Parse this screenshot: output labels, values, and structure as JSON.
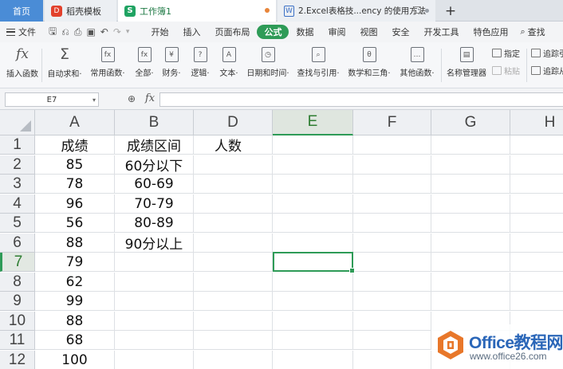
{
  "tabs": {
    "home": "首页",
    "template": "稻壳模板",
    "workbook": "工作簿1",
    "web": "2.Excel表格技...ency 的使用方法",
    "add": "+"
  },
  "menu": {
    "file": "文件",
    "tabs": [
      "开始",
      "插入",
      "页面布局",
      "公式",
      "数据",
      "审阅",
      "视图",
      "安全",
      "开发工具",
      "特色应用"
    ],
    "active": "公式",
    "search": "查找"
  },
  "ribbon": {
    "buttons": [
      {
        "label": "插入函数",
        "icon": "fx"
      },
      {
        "label": "自动求和·",
        "icon": "Σ"
      },
      {
        "label": "常用函数·",
        "icon": "fx"
      },
      {
        "label": "全部·",
        "icon": "fx"
      },
      {
        "label": "财务·",
        "icon": "¥"
      },
      {
        "label": "逻辑·",
        "icon": "?"
      },
      {
        "label": "文本·",
        "icon": "A"
      },
      {
        "label": "日期和时间·",
        "icon": "◷"
      },
      {
        "label": "查找与引用·",
        "icon": "⌕"
      },
      {
        "label": "数学和三角·",
        "icon": "θ"
      },
      {
        "label": "其他函数·",
        "icon": "…"
      },
      {
        "label": "名称管理器",
        "icon": "▤"
      }
    ],
    "small": {
      "specify": "指定",
      "paste": "粘贴",
      "trace1": "追踪引",
      "trace2": "追踪从"
    }
  },
  "formula_bar": {
    "name_box": "E7",
    "fx": "fx",
    "value": ""
  },
  "sheet": {
    "columns": [
      "A",
      "B",
      "D",
      "E",
      "F",
      "G",
      "H"
    ],
    "selected_column": "E",
    "rows": [
      "1",
      "2",
      "3",
      "4",
      "5",
      "6",
      "7",
      "8",
      "9",
      "10",
      "11",
      "12"
    ],
    "selected_row": "7",
    "colA": [
      "成绩",
      "85",
      "78",
      "96",
      "56",
      "88",
      "79",
      "62",
      "99",
      "88",
      "68",
      "100"
    ],
    "colB": [
      "成绩区间",
      "60分以下",
      "60-69",
      "70-79",
      "80-89",
      "90分以上",
      "",
      "",
      "",
      "",
      "",
      ""
    ],
    "colD": [
      "人数",
      "",
      "",
      "",
      "",
      "",
      "",
      "",
      "",
      "",
      "",
      ""
    ],
    "selected_cell": "E7"
  },
  "watermark": {
    "title": "Office教程网",
    "url": "www.office26.com"
  }
}
